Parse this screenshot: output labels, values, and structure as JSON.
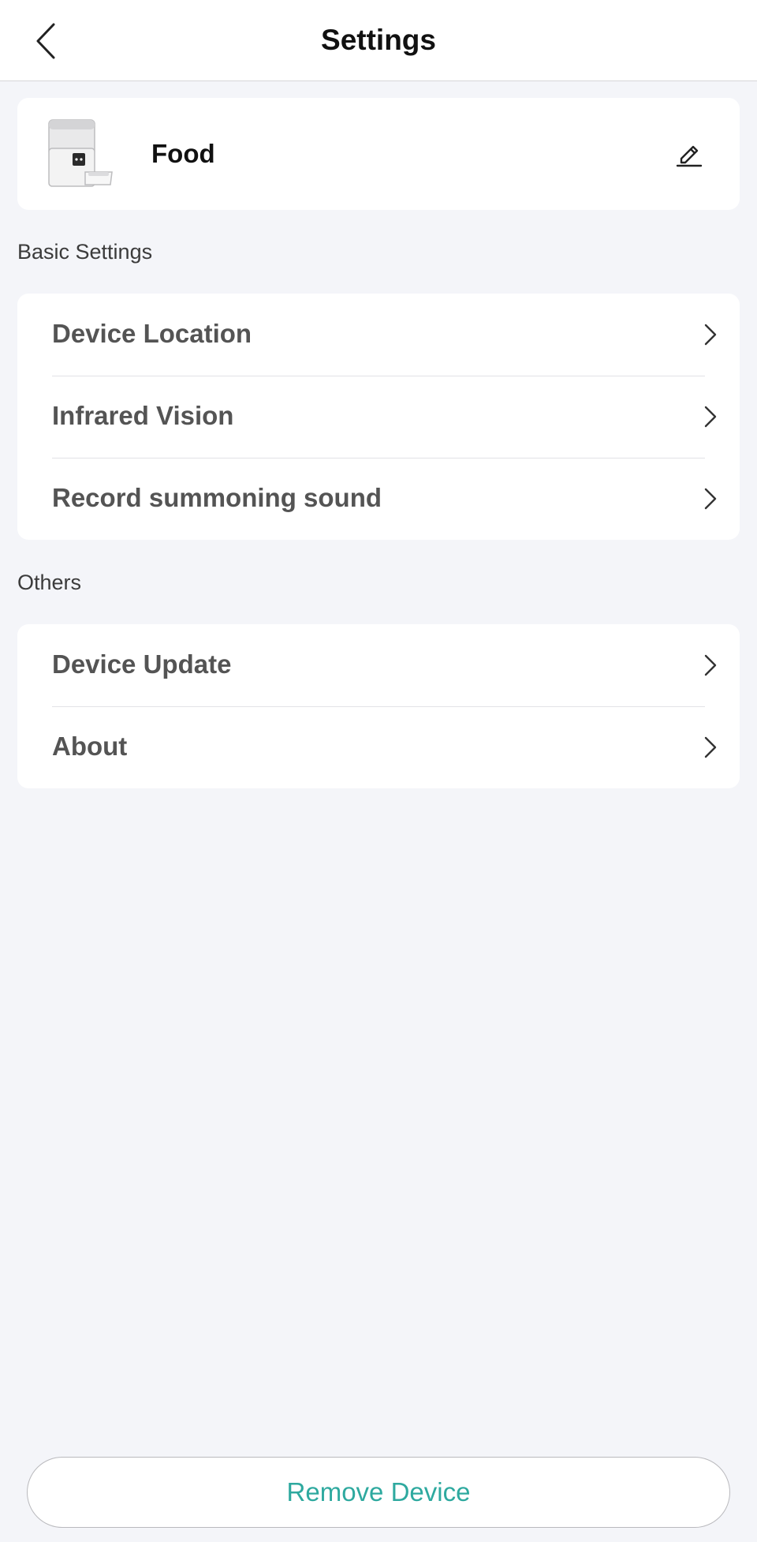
{
  "header": {
    "title": "Settings",
    "back_icon": "chevron-left-icon"
  },
  "device": {
    "name": "Food",
    "image": "pet-feeder-image",
    "edit_icon": "pencil-icon"
  },
  "sections": {
    "basic": {
      "label": "Basic Settings",
      "items": [
        {
          "label": "Device Location"
        },
        {
          "label": "Infrared Vision"
        },
        {
          "label": "Record summoning sound"
        }
      ]
    },
    "others": {
      "label": "Others",
      "items": [
        {
          "label": "Device Update"
        },
        {
          "label": "About"
        }
      ]
    }
  },
  "footer": {
    "remove_label": "Remove Device",
    "accent_color": "#2ea99f"
  }
}
